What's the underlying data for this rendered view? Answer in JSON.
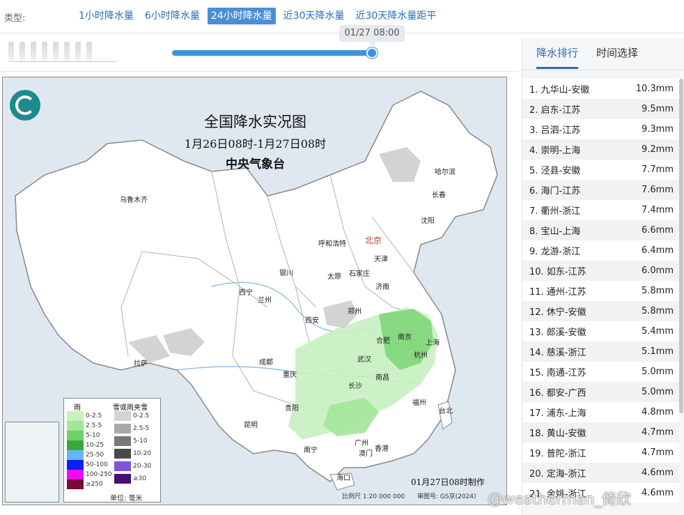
{
  "header": {
    "type_label": "类型:",
    "tabs": [
      {
        "label": "1小时降水量",
        "active": false
      },
      {
        "label": "6小时降水量",
        "active": false
      },
      {
        "label": "24小时降水量",
        "active": true
      },
      {
        "label": "近30天降水量",
        "active": false
      },
      {
        "label": "近30天降水量距平",
        "active": false
      }
    ]
  },
  "timeline": {
    "current_time": "01/27 08:00",
    "progress_fraction": 1.0
  },
  "map": {
    "title": "全国降水实况图",
    "subtitle": "1月26日08时-1月27日08时",
    "organization": "中央气象台",
    "made_time": "01月27日08时制作",
    "scale": "比例尺 1:20 000 000",
    "review": "审图号: GS京(2024)",
    "cities": [
      "乌鲁木齐",
      "哈尔滨",
      "长春",
      "沈阳",
      "呼和浩特",
      "北京",
      "天津",
      "银川",
      "太原",
      "石家庄",
      "济南",
      "西宁",
      "兰州",
      "郑州",
      "西安",
      "合肥",
      "南京",
      "上海",
      "拉萨",
      "成都",
      "武汉",
      "杭州",
      "重庆",
      "长沙",
      "南昌",
      "福州",
      "贵阳",
      "台北",
      "昆明",
      "南宁",
      "广州",
      "澳门",
      "香港",
      "海口"
    ],
    "legend": {
      "rain_title": "雨",
      "snow_title": "雪或雨夹雪",
      "rain": [
        {
          "label": "0-2.5",
          "color": "#c8f0c0"
        },
        {
          "label": "2.5-5",
          "color": "#a3e69a"
        },
        {
          "label": "5-10",
          "color": "#6fd06a"
        },
        {
          "label": "10-25",
          "color": "#3aa83a"
        },
        {
          "label": "25-50",
          "color": "#62b7f7"
        },
        {
          "label": "50-100",
          "color": "#0a20f2"
        },
        {
          "label": "100-250",
          "color": "#f20af2"
        },
        {
          "label": "≥250",
          "color": "#7a0a3a"
        }
      ],
      "snow": [
        {
          "label": "0-2.5",
          "color": "#d4d4d4"
        },
        {
          "label": "2.5-5",
          "color": "#a8a8a8"
        },
        {
          "label": "5-10",
          "color": "#787878"
        },
        {
          "label": "10-20",
          "color": "#4a4a4a"
        },
        {
          "label": "20-30",
          "color": "#7f55e0"
        },
        {
          "label": "≥30",
          "color": "#4b0a7a"
        }
      ],
      "unit": "单位: 毫米"
    }
  },
  "panel": {
    "tabs": [
      {
        "label": "降水排行",
        "active": true
      },
      {
        "label": "时间选择",
        "active": false
      }
    ],
    "ranking": [
      {
        "name": "1. 九华山-安徽",
        "value": "10.3mm"
      },
      {
        "name": "2. 启东-江苏",
        "value": "9.5mm"
      },
      {
        "name": "3. 吕泗-江苏",
        "value": "9.3mm"
      },
      {
        "name": "4. 崇明-上海",
        "value": "9.2mm"
      },
      {
        "name": "5. 泾县-安徽",
        "value": "7.7mm"
      },
      {
        "name": "6. 海门-江苏",
        "value": "7.6mm"
      },
      {
        "name": "7. 衢州-浙江",
        "value": "7.4mm"
      },
      {
        "name": "8. 宝山-上海",
        "value": "6.6mm"
      },
      {
        "name": "9. 龙游-浙江",
        "value": "6.4mm"
      },
      {
        "name": "10. 如东-江苏",
        "value": "6.0mm"
      },
      {
        "name": "11. 通州-江苏",
        "value": "5.8mm"
      },
      {
        "name": "12. 休宁-安徽",
        "value": "5.8mm"
      },
      {
        "name": "13. 郎溪-安徽",
        "value": "5.4mm"
      },
      {
        "name": "14. 慈溪-浙江",
        "value": "5.1mm"
      },
      {
        "name": "15. 南通-江苏",
        "value": "5.0mm"
      },
      {
        "name": "16. 都安-广西",
        "value": "5.0mm"
      },
      {
        "name": "17. 浦东-上海",
        "value": "4.8mm"
      },
      {
        "name": "18. 黄山-安徽",
        "value": "4.7mm"
      },
      {
        "name": "19. 普陀-浙江",
        "value": "4.7mm"
      },
      {
        "name": "20. 定海-浙江",
        "value": "4.6mm"
      },
      {
        "name": "21. 余姚-浙江",
        "value": "4.6mm"
      }
    ]
  },
  "watermark": "@weatherman_倚欣"
}
